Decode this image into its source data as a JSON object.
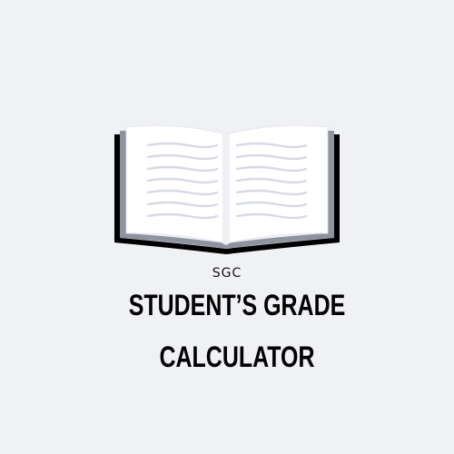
{
  "logo": {
    "icon": "open-book-icon",
    "abbreviation": "SGC",
    "title_line1": "STUDENT’S GRADE",
    "title_line2": "CALCULATOR"
  },
  "colors": {
    "background": "#f0f1f5",
    "book_outline": "#000000",
    "book_cover": "#8e939f",
    "book_page": "#ffffff",
    "page_lines": "#d6dae4",
    "text": "#000000"
  }
}
